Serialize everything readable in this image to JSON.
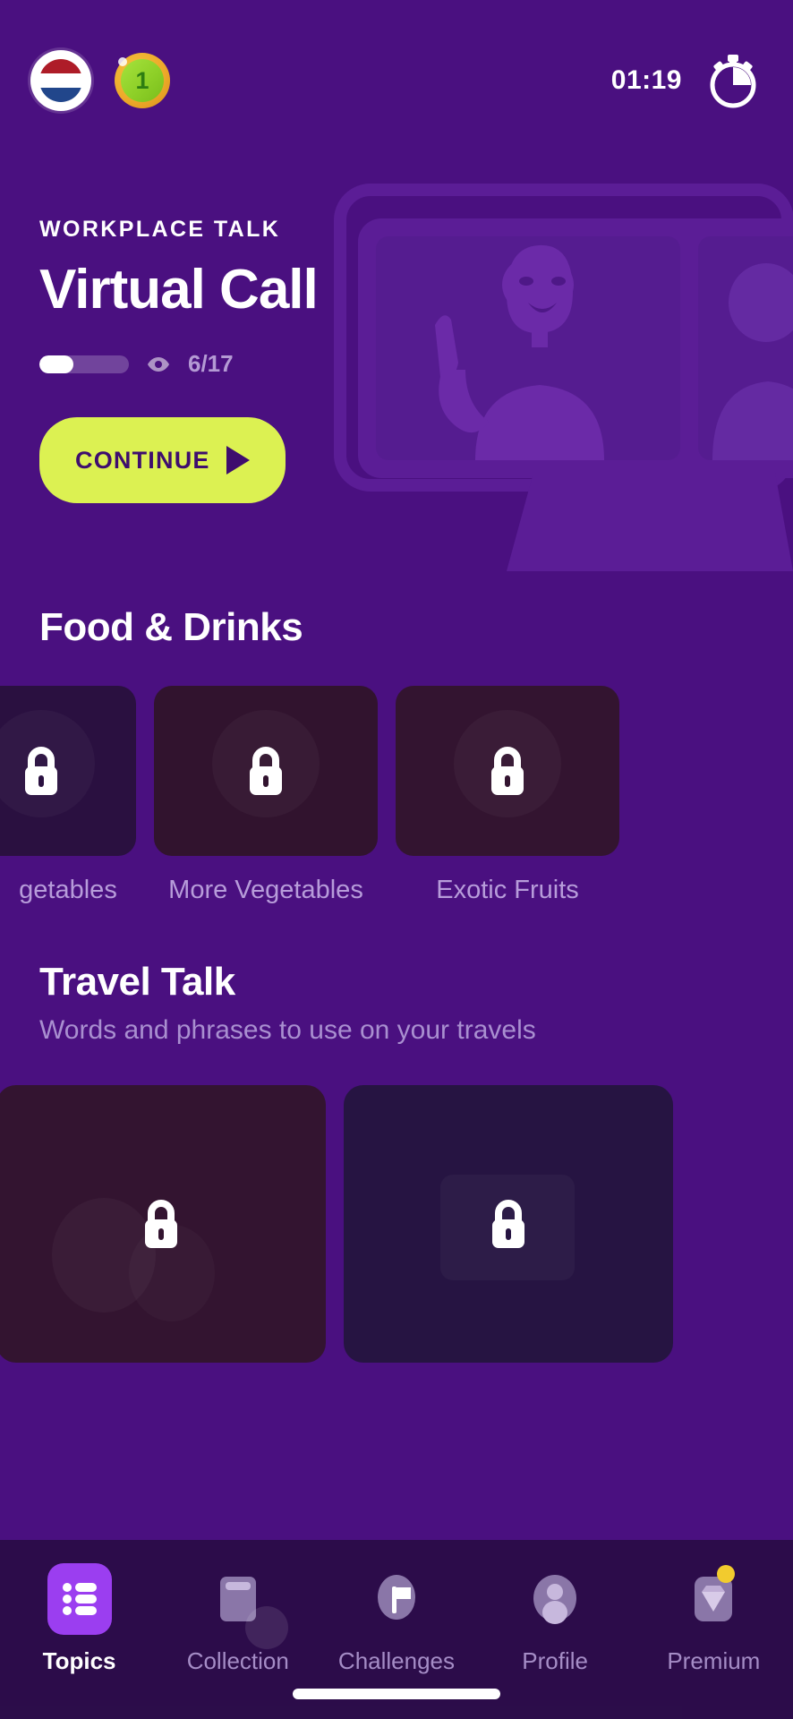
{
  "topbar": {
    "flag_icon": "dutch-flag-icon",
    "coin_icon": "coin-icon",
    "coin_value": "1",
    "timer": "01:19",
    "stopwatch_icon": "stopwatch-icon"
  },
  "hero": {
    "eyebrow": "WORKPLACE TALK",
    "title": "Virtual Call",
    "progress_count": "6/17",
    "progress_percent": 38,
    "eye_icon": "eye-icon",
    "continue_label": "CONTINUE",
    "play_icon": "play-icon",
    "illustration": "video-call-illustration",
    "accent_color": "#dcf152",
    "button_text_color": "#3e0d6e"
  },
  "sections": [
    {
      "title": "Food & Drinks",
      "subtitle": "",
      "cards": [
        {
          "label": "getables",
          "locked": true,
          "lock_icon": "lock-icon"
        },
        {
          "label": "More Vegetables",
          "locked": true,
          "lock_icon": "lock-icon"
        },
        {
          "label": "Exotic Fruits",
          "locked": true,
          "lock_icon": "lock-icon"
        }
      ]
    },
    {
      "title": "Travel Talk",
      "subtitle": "Words and phrases to use on your travels",
      "cards": [
        {
          "label": "",
          "locked": true,
          "lock_icon": "lock-icon"
        },
        {
          "label": "",
          "locked": true,
          "lock_icon": "lock-icon"
        }
      ]
    }
  ],
  "bottom_nav": {
    "items": [
      {
        "label": "Topics",
        "icon": "list-icon",
        "active": true
      },
      {
        "label": "Collection",
        "icon": "book-icon",
        "active": false
      },
      {
        "label": "Challenges",
        "icon": "flag-icon",
        "active": false
      },
      {
        "label": "Profile",
        "icon": "person-icon",
        "active": false
      },
      {
        "label": "Premium",
        "icon": "diamond-icon",
        "active": false,
        "badge": true
      }
    ],
    "active_color": "#9b3ef0"
  },
  "colors": {
    "background": "#4a1080",
    "accent_lime": "#dcf152",
    "nav_active": "#9b3ef0",
    "muted_text": "#a98fd0"
  }
}
